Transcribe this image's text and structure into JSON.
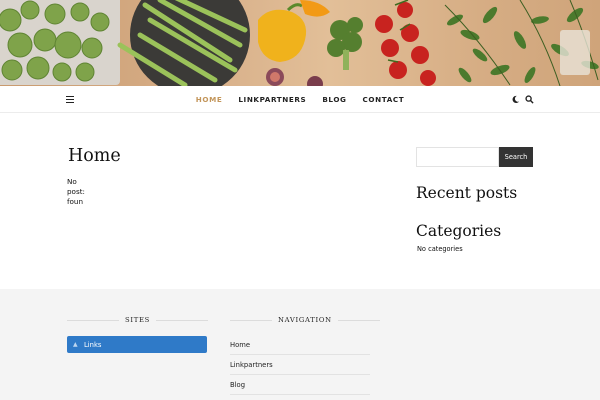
{
  "nav": {
    "items": [
      {
        "label": "HOME",
        "active": true
      },
      {
        "label": "LINKPARTNERS",
        "active": false
      },
      {
        "label": "BLOG",
        "active": false
      },
      {
        "label": "CONTACT",
        "active": false
      }
    ],
    "icons": [
      "hamburger-menu-icon",
      "moon-icon",
      "search-icon"
    ],
    "active_color": "#c3965b"
  },
  "main": {
    "title": "Home",
    "empty_message": "No post: foun"
  },
  "sidebar": {
    "search": {
      "value": "",
      "placeholder": "",
      "button_label": "Search"
    },
    "recent_posts_title": "Recent posts",
    "categories_title": "Categories",
    "categories_empty": "No categories"
  },
  "footer": {
    "sites": {
      "heading": "SITES",
      "button_label": "Links",
      "button_color": "#2f7ac8"
    },
    "navigation": {
      "heading": "NAVIGATION",
      "items": [
        "Home",
        "Linkpartners",
        "Blog"
      ]
    },
    "background": "#f4f4f4"
  }
}
